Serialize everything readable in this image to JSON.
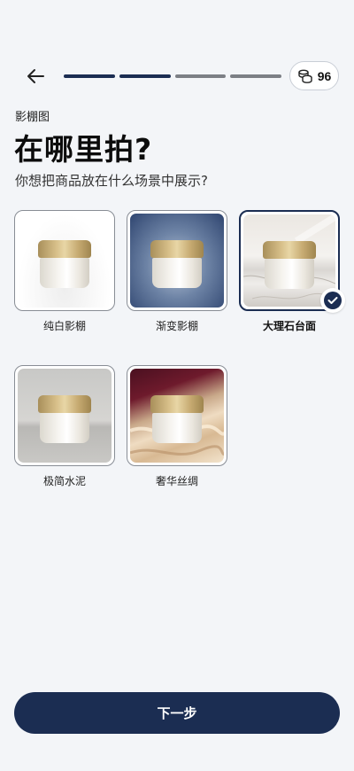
{
  "header": {
    "back_icon": "arrow-left-icon",
    "progress": {
      "total_steps": 4,
      "completed_steps": 2,
      "active_color": "#1b2d52",
      "inactive_color": "#7c7f85"
    },
    "credits": {
      "icon": "coins-icon",
      "value": "96"
    }
  },
  "eyebrow": "影棚图",
  "title": "在哪里拍?",
  "subtitle": "你想把商品放在什么场景中展示?",
  "options": [
    {
      "label": "纯白影棚",
      "selected": false,
      "background": "white"
    },
    {
      "label": "渐变影棚",
      "selected": false,
      "background": "blue-gradient"
    },
    {
      "label": "大理石台面",
      "selected": true,
      "background": "marble"
    },
    {
      "label": "极简水泥",
      "selected": false,
      "background": "concrete"
    },
    {
      "label": "奢华丝绸",
      "selected": false,
      "background": "silk"
    }
  ],
  "next_button": "下一步",
  "colors": {
    "accent": "#1b2d52",
    "background": "#f3f5f8"
  }
}
